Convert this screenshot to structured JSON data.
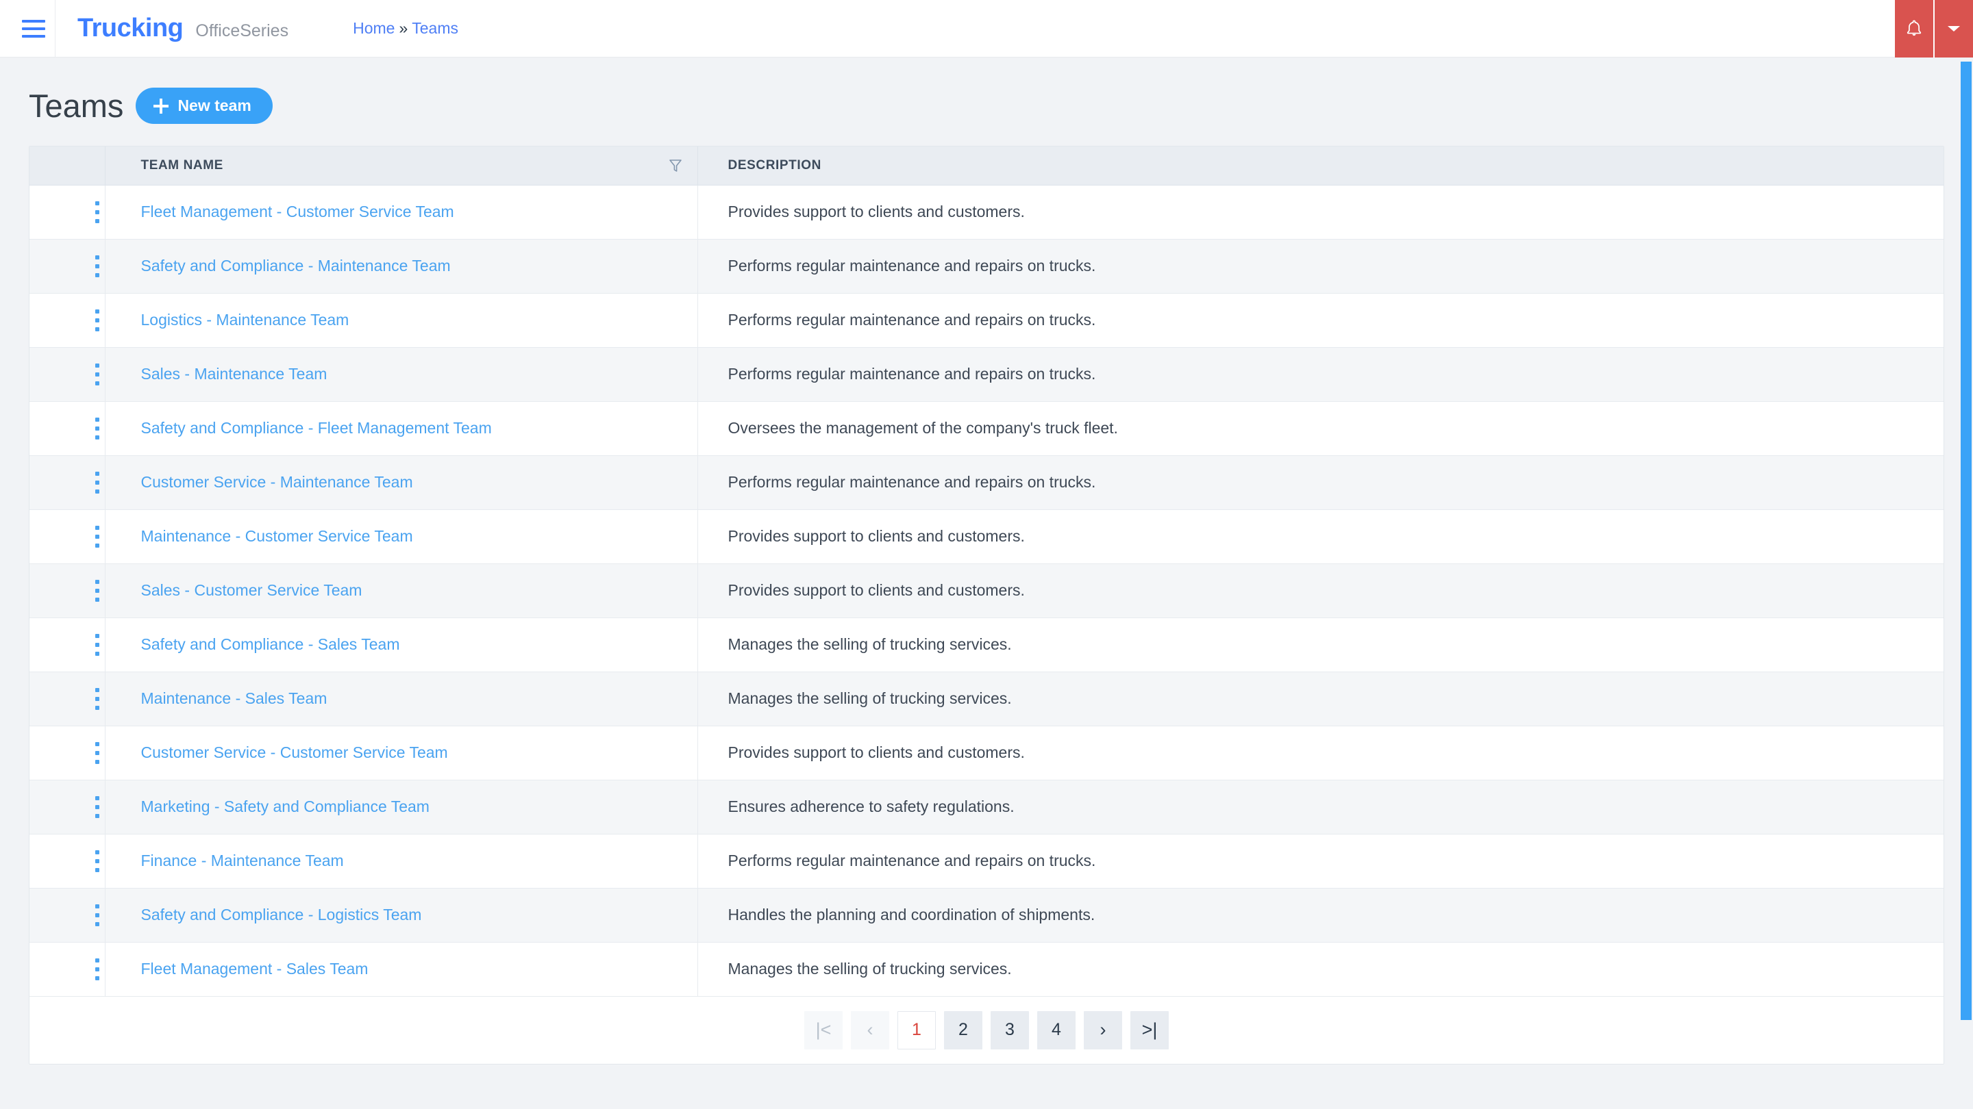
{
  "topbar": {
    "menu_icon": "hamburger-icon",
    "brand_main": "Trucking",
    "brand_sub": "OfficeSeries",
    "breadcrumb": {
      "home": "Home",
      "separator": "»",
      "current": "Teams"
    },
    "notification_icon": "bell-icon",
    "dropdown_icon": "caret-down-icon",
    "accent_red": "#d9534f",
    "accent_blue": "#3d7eff"
  },
  "page": {
    "title": "Teams",
    "new_button_label": "New team",
    "new_button_icon": "plus-icon",
    "new_button_color": "#39a2f7"
  },
  "table": {
    "columns": [
      {
        "key": "menu",
        "label": ""
      },
      {
        "key": "name",
        "label": "TEAM NAME",
        "filter_icon": "filter-funnel-icon"
      },
      {
        "key": "description",
        "label": "DESCRIPTION"
      }
    ],
    "row_menu_icon": "kebab-menu-icon",
    "link_color": "#4aa3f0",
    "rows": [
      {
        "name": "Fleet Management - Customer Service Team",
        "description": "Provides support to clients and customers."
      },
      {
        "name": "Safety and Compliance - Maintenance Team",
        "description": "Performs regular maintenance and repairs on trucks."
      },
      {
        "name": "Logistics - Maintenance Team",
        "description": "Performs regular maintenance and repairs on trucks."
      },
      {
        "name": "Sales - Maintenance Team",
        "description": "Performs regular maintenance and repairs on trucks."
      },
      {
        "name": "Safety and Compliance - Fleet Management Team",
        "description": "Oversees the management of the company's truck fleet."
      },
      {
        "name": "Customer Service - Maintenance Team",
        "description": "Performs regular maintenance and repairs on trucks."
      },
      {
        "name": "Maintenance - Customer Service Team",
        "description": "Provides support to clients and customers."
      },
      {
        "name": "Sales - Customer Service Team",
        "description": "Provides support to clients and customers."
      },
      {
        "name": "Safety and Compliance - Sales Team",
        "description": "Manages the selling of trucking services."
      },
      {
        "name": "Maintenance - Sales Team",
        "description": "Manages the selling of trucking services."
      },
      {
        "name": "Customer Service - Customer Service Team",
        "description": "Provides support to clients and customers."
      },
      {
        "name": "Marketing - Safety and Compliance Team",
        "description": "Ensures adherence to safety regulations."
      },
      {
        "name": "Finance - Maintenance Team",
        "description": "Performs regular maintenance and repairs on trucks."
      },
      {
        "name": "Safety and Compliance - Logistics Team",
        "description": "Handles the planning and coordination of shipments."
      },
      {
        "name": "Fleet Management - Sales Team",
        "description": "Manages the selling of trucking services."
      }
    ]
  },
  "pagination": {
    "first_label": "|<",
    "prev_label": "‹",
    "pages": [
      "1",
      "2",
      "3",
      "4"
    ],
    "current_page": "1",
    "next_label": "›",
    "last_label": ">|",
    "active_color": "#d9453c"
  },
  "scrollbar": {
    "thumb_color": "#3aa3f7"
  }
}
